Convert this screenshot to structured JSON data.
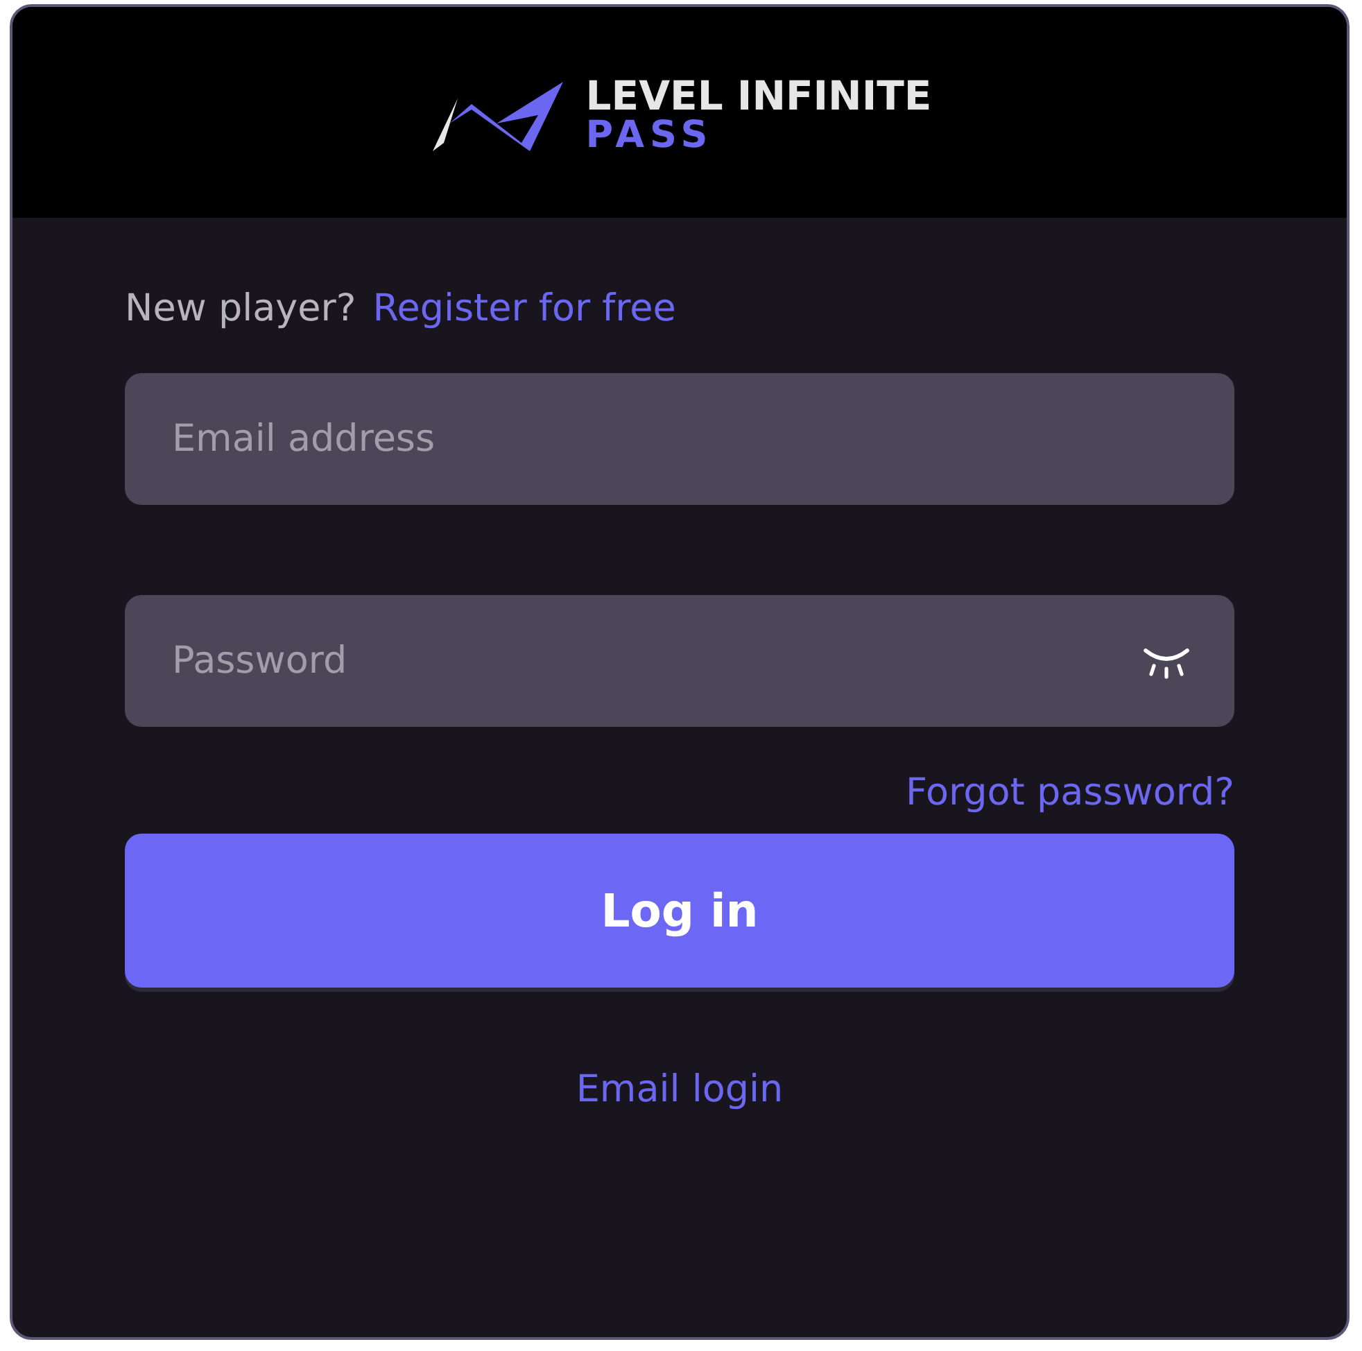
{
  "logo": {
    "line1": "LEVEL INFINITE",
    "line2": "PASS"
  },
  "register": {
    "prompt": "New player?",
    "link": "Register for free"
  },
  "email": {
    "placeholder": "Email address"
  },
  "password": {
    "placeholder": "Password",
    "visible": false
  },
  "forgot": "Forgot password?",
  "login_button": "Log in",
  "alt_login": "Email login"
}
